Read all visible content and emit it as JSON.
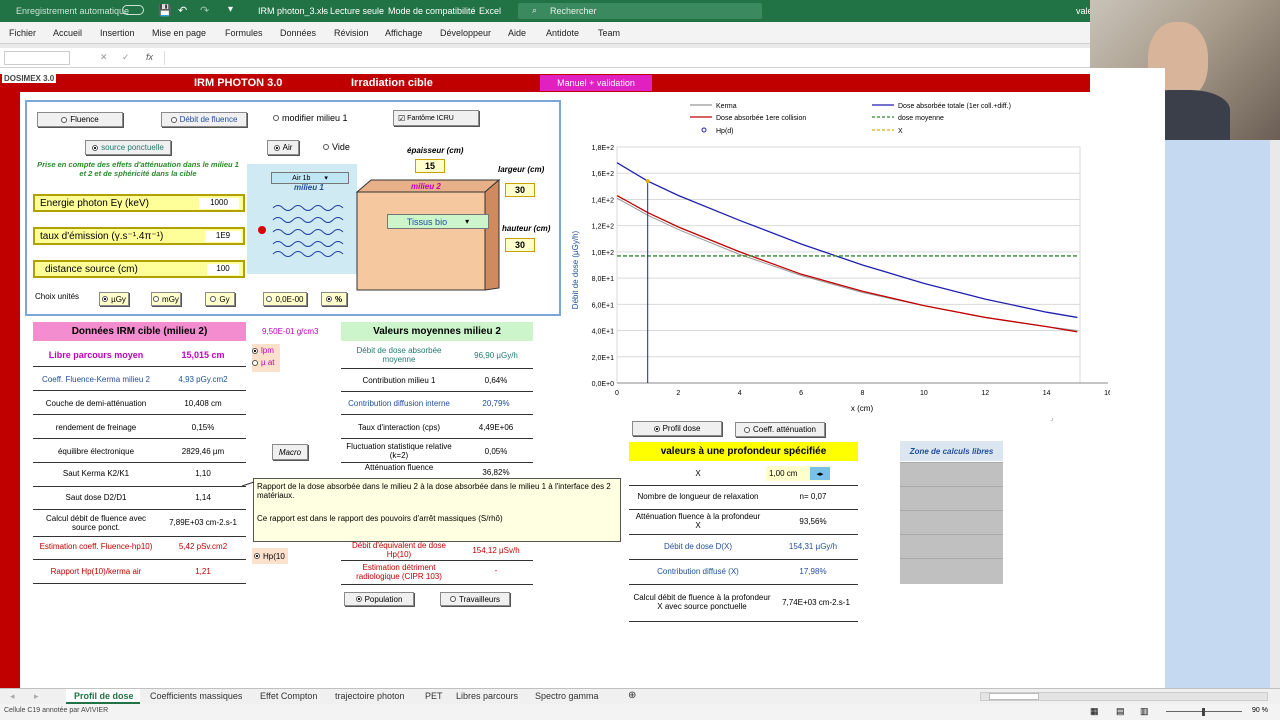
{
  "titlebar": {
    "autosave": "Enregistrement automatique",
    "filename": "IRM photon_3.xls",
    "readonly": "Lecture seule",
    "compat": "Mode de compatibilité",
    "app": "Excel",
    "search_placeholder": "Rechercher",
    "user": "vale"
  },
  "ribbon_tabs": [
    "Fichier",
    "Accueil",
    "Insertion",
    "Mise en page",
    "Formules",
    "Données",
    "Révision",
    "Affichage",
    "Développeur",
    "Aide",
    "Antidote",
    "Team"
  ],
  "header": {
    "logo": "DOSIMEX 3.0",
    "title": "IRM PHOTON 3.0",
    "subtitle": "Irradiation cible",
    "manual_button": "Manuel + validation"
  },
  "panel": {
    "fluence_btn": "Fluence",
    "debit_fluence_btn": "Débit de fluence",
    "modifier_milieu": "modifier milieu 1",
    "fantome": "Fantôme ICRU",
    "source_ponctuelle": "source ponctuelle",
    "air": "Air",
    "vide": "Vide",
    "note": "Prise en compte des effets d'atténuation dans le milieu 1 et 2 et de sphéricité dans la cible",
    "epaisseur_label": "épaisseur (cm)",
    "epaisseur_value": "15",
    "largeur_label": "largeur (cm)",
    "largeur_value": "30",
    "hauteur_label": "hauteur (cm)",
    "hauteur_value": "30",
    "milieu1_select": "Air 1b",
    "milieu1_label": "milieu 1",
    "milieu2_label": "milieu 2",
    "milieu2_select": "Tissus bio",
    "energie_label": "Energie photon  Eγ (keV)",
    "energie_value": "1000",
    "taux_label": "taux d'émission  (γ.s⁻¹.4π⁻¹)",
    "taux_value": "1E9",
    "distance_label": "distance source (cm)",
    "distance_value": "100",
    "choix_unites": "Choix unités",
    "units": [
      "µGy",
      "mGy",
      "Gy"
    ],
    "format_btn": "0,0E-00",
    "percent_btn": "%"
  },
  "irm_table": {
    "title": "Données IRM cible (milieu 2)",
    "density": "9,50E-01 g/cm3",
    "rows": [
      {
        "label": "Libre parcours moyen",
        "value": "15,015 cm"
      },
      {
        "label": "Coeff. Fluence-Kerma milieu 2",
        "value": "4,93 pGy.cm2"
      },
      {
        "label": "Couche de demi-atténuation",
        "value": "10,408 cm"
      },
      {
        "label": "rendement de freinage",
        "value": "0,15%"
      },
      {
        "label": "équilibre électronique",
        "value": "2829,46 µm"
      },
      {
        "label": "Saut Kerma K2/K1",
        "value": "1,10"
      },
      {
        "label": "Saut dose D2/D1",
        "value": "1,14"
      },
      {
        "label": "Calcul débit de fluence avec source ponct.",
        "value": "7,89E+03 cm-2.s-1"
      },
      {
        "label": "Estimation coeff. Fluence-hp10)",
        "value": "5,42 pSv.cm2"
      },
      {
        "label": "Rapport Hp(10)/kerma air",
        "value": "1,21"
      }
    ],
    "lpm": "lpm",
    "mu_at": "µ at",
    "macro": "Macro",
    "hp10": "Hp(10"
  },
  "moyennes": {
    "title": "Valeurs moyennes milieu 2",
    "rows": [
      {
        "label": "Débit de dose absorbée moyenne",
        "value": "96,90 µGy/h"
      },
      {
        "label": "Contribution milieu 1",
        "value": "0,64%"
      },
      {
        "label": "Contribution diffusion interne",
        "value": "20,79%"
      },
      {
        "label": "Taux d'interaction (cps)",
        "value": "4,49E+06"
      },
      {
        "label": "Fluctuation statistique relative (k=2)",
        "value": "0,05%"
      },
      {
        "label": "Atténuation fluence",
        "value": "36,82%"
      },
      {
        "label": "Débit d'équivalent de dose Hp(10)",
        "value": "154,12 µSv/h"
      },
      {
        "label": "Estimation détriment radiologique (CIPR 103)",
        "value": "-"
      }
    ],
    "population": "Population",
    "travailleurs": "Travailleurs"
  },
  "tooltip": {
    "line1": "Rapport de la dose absorbée dans le milieu 2 à la dose absorbée dans le milieu 1 à l'interface des 2 matériaux.",
    "line2": "Ce rapport est dans le rapport des pouvoirs d'arrêt massiques (S/rhô)"
  },
  "profondeur": {
    "profil_dose": "Profil dose",
    "coeff_att": "Coeff. atténuation",
    "title": "valeurs à une profondeur spécifiée",
    "x_label": "X",
    "x_value": "1,00 cm",
    "rows": [
      {
        "label": "Nombre de longueur de relaxation",
        "value": "n= 0,07"
      },
      {
        "label": "Atténuation fluence à la profondeur X",
        "value": "93,56%"
      },
      {
        "label": "Débit de dose D(X)",
        "value": "154,31 µGy/h"
      },
      {
        "label": "Contribution diffusé (X)",
        "value": "17,98%"
      },
      {
        "label": "Calcul débit de fluence à la profondeur X avec source ponctuelle",
        "value": "7,74E+03 cm-2.s-1"
      }
    ],
    "zone_libre": "Zone de calculs libres"
  },
  "chart_data": {
    "type": "line",
    "xlabel": "x (cm)",
    "ylabel": "Débit de dose (µGy/h)",
    "xlim": [
      0,
      16
    ],
    "ylim": [
      0,
      180
    ],
    "x_ticks": [
      "0",
      "2",
      "4",
      "6",
      "8",
      "10",
      "12",
      "14",
      "16"
    ],
    "y_ticks": [
      "0,0E+0",
      "2,0E+1",
      "4,0E+1",
      "6,0E+1",
      "8,0E+1",
      "1,0E+2",
      "1,2E+2",
      "1,4E+2",
      "1,6E+2",
      "1,8E+2"
    ],
    "legend_position": "top",
    "x": [
      0,
      1,
      2,
      4,
      6,
      8,
      10,
      12,
      14,
      15
    ],
    "series": [
      {
        "name": "Kerma",
        "color": "#999999",
        "values": [
          141,
          128,
          117,
          98,
          82,
          69,
          59,
          50,
          43,
          40
        ]
      },
      {
        "name": "Dose absorbée totale (1er coll.+diff.)",
        "color": "#1f1fb0",
        "values": [
          168,
          154,
          143,
          124,
          106,
          90,
          76,
          64,
          54,
          50
        ]
      },
      {
        "name": "Dose absorbée 1ere collision",
        "color": "#c00000",
        "values": [
          143,
          130,
          119,
          100,
          83,
          70,
          59,
          50,
          43,
          39
        ]
      },
      {
        "name": "dose moyenne",
        "color": "#2e8b2e",
        "values": [
          96.9,
          96.9,
          96.9,
          96.9,
          96.9,
          96.9,
          96.9,
          96.9,
          96.9,
          96.9
        ]
      },
      {
        "name": "Hp(d)",
        "color": "#1f1fb0",
        "values": []
      },
      {
        "name": "X",
        "color": "#e0b000",
        "values": []
      }
    ],
    "marker_x": 1
  },
  "sheet_tabs": [
    "Profil de dose",
    "Coefficients massiques",
    "Effet Compton",
    "trajectoire photon",
    "PET",
    "Libres parcours",
    "Spectro gamma"
  ],
  "status": {
    "left": "Cellule C19 annotée par AVIVIER",
    "zoom": "90 %"
  }
}
